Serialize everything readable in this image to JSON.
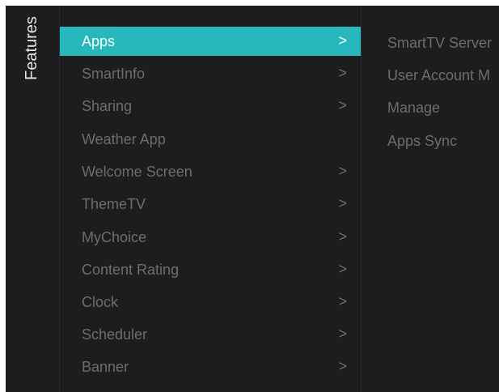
{
  "sidebar": {
    "title": "Features"
  },
  "menu": {
    "items": [
      {
        "label": "Apps",
        "chevron": ">",
        "active": true
      },
      {
        "label": "SmartInfo",
        "chevron": ">"
      },
      {
        "label": "Sharing",
        "chevron": ">"
      },
      {
        "label": "Weather App",
        "chevron": ""
      },
      {
        "label": "Welcome Screen",
        "chevron": ">"
      },
      {
        "label": "ThemeTV",
        "chevron": ">"
      },
      {
        "label": "MyChoice",
        "chevron": ">"
      },
      {
        "label": "Content Rating",
        "chevron": ">"
      },
      {
        "label": "Clock",
        "chevron": ">"
      },
      {
        "label": "Scheduler",
        "chevron": ">"
      },
      {
        "label": "Banner",
        "chevron": ">"
      }
    ]
  },
  "submenu": {
    "items": [
      "SmartTV Server",
      "User Account M",
      "Manage",
      "Apps Sync"
    ]
  },
  "colors": {
    "accent": "#27b8bd",
    "background": "#1d1d1f",
    "text_dim": "#6d6d6f"
  }
}
